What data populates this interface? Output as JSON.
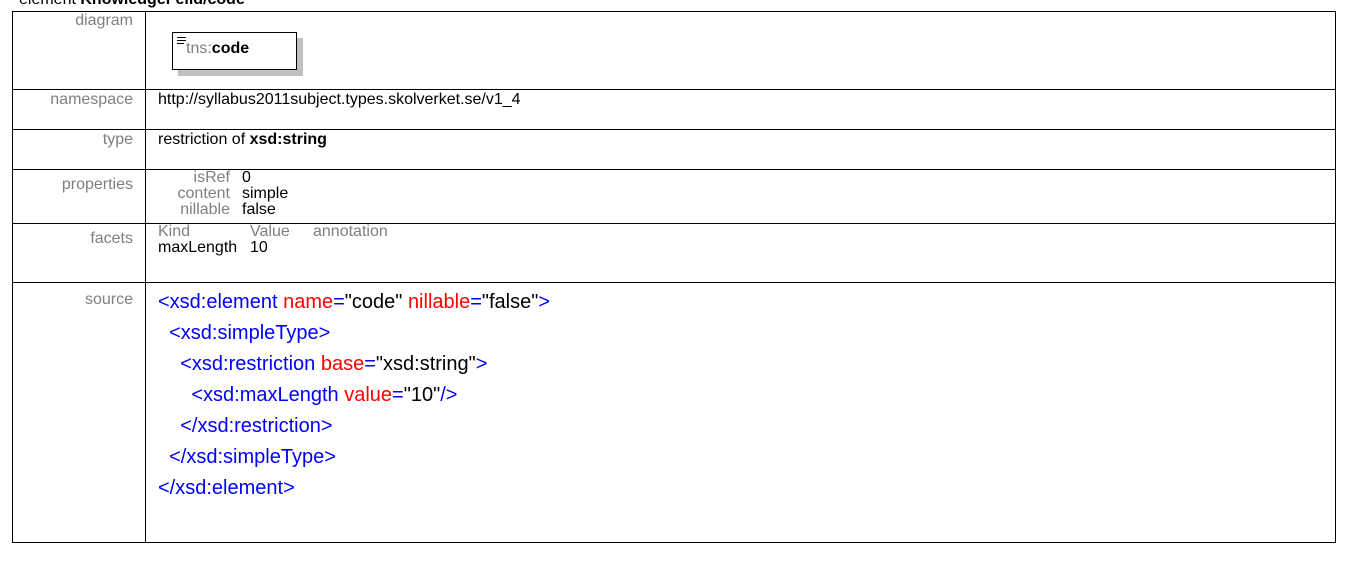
{
  "heading": {
    "prefix": "element",
    "name": "KnowledgeFeild/code"
  },
  "rows": {
    "diagram": {
      "label": "diagram",
      "prefix": "tns:",
      "name": "code"
    },
    "namespace": {
      "label": "namespace",
      "value": "http://syllabus2011subject.types.skolverket.se/v1_4"
    },
    "type": {
      "label": "type",
      "text": "restriction of ",
      "base": "xsd:string"
    },
    "properties": {
      "label": "properties",
      "items": [
        {
          "key": "isRef",
          "value": "0"
        },
        {
          "key": "content",
          "value": "simple"
        },
        {
          "key": "nillable",
          "value": "false"
        }
      ]
    },
    "facets": {
      "label": "facets",
      "headers": [
        "Kind",
        "Value",
        "annotation"
      ],
      "rows": [
        {
          "kind": "maxLength",
          "value": "10",
          "annotation": ""
        }
      ]
    },
    "source": {
      "label": "source",
      "lines": [
        "<xsd:element name=\"code\" nillable=\"false\">",
        "  <xsd:simpleType>",
        "    <xsd:restriction base=\"xsd:string\">",
        "      <xsd:maxLength value=\"10\"/>",
        "    </xsd:restriction>",
        "  </xsd:simpleType>",
        "</xsd:element>"
      ]
    }
  }
}
